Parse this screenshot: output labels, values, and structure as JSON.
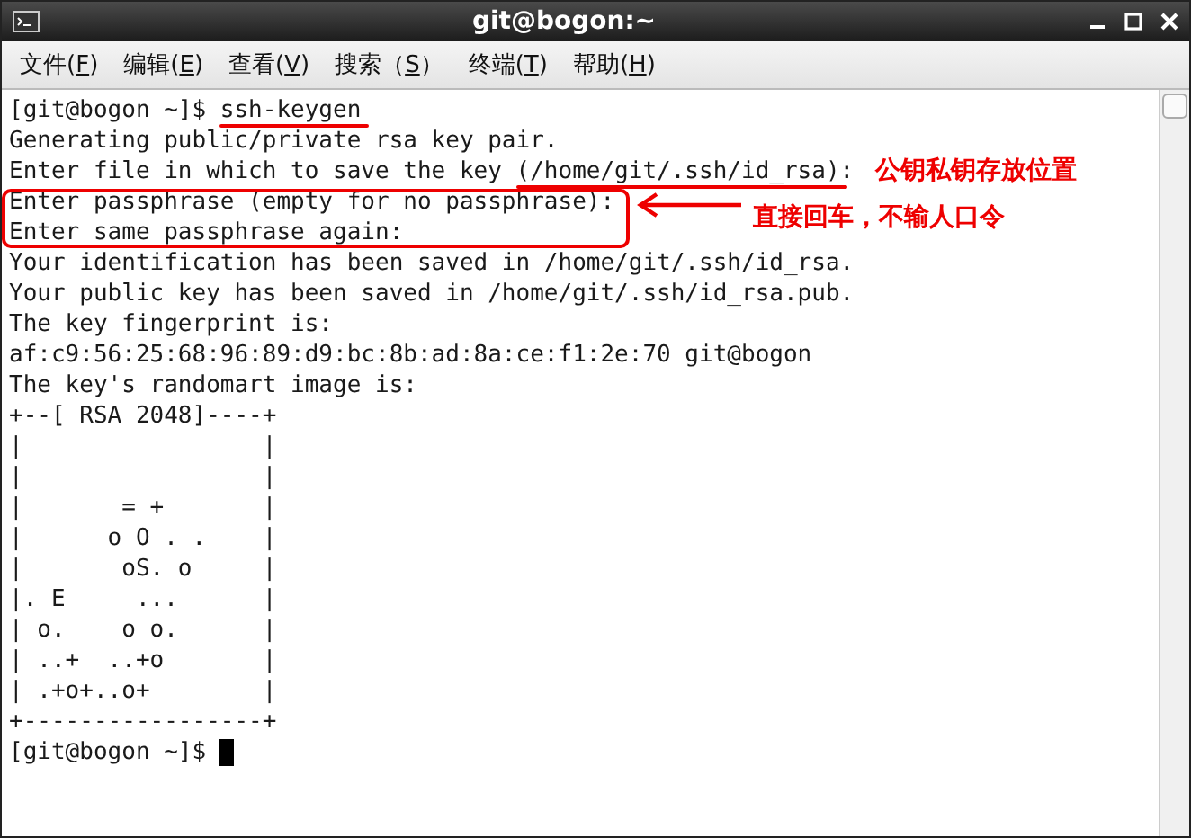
{
  "window": {
    "title": "git@bogon:~"
  },
  "menu": [
    {
      "label_before": "文件(",
      "mnemonic": "F",
      "label_after": ")"
    },
    {
      "label_before": "编辑(",
      "mnemonic": "E",
      "label_after": ")"
    },
    {
      "label_before": "查看(",
      "mnemonic": "V",
      "label_after": ")"
    },
    {
      "label_before": "搜索（",
      "mnemonic": "S",
      "label_after": "）"
    },
    {
      "label_before": "终端(",
      "mnemonic": "T",
      "label_after": ")"
    },
    {
      "label_before": "帮助(",
      "mnemonic": "H",
      "label_after": ")"
    }
  ],
  "terminal": {
    "lines": [
      "[git@bogon ~]$ ssh-keygen",
      "Generating public/private rsa key pair.",
      "Enter file in which to save the key (/home/git/.ssh/id_rsa):",
      "Enter passphrase (empty for no passphrase):",
      "Enter same passphrase again:",
      "Your identification has been saved in /home/git/.ssh/id_rsa.",
      "Your public key has been saved in /home/git/.ssh/id_rsa.pub.",
      "The key fingerprint is:",
      "af:c9:56:25:68:96:89:d9:bc:8b:ad:8a:ce:f1:2e:70 git@bogon",
      "The key's randomart image is:",
      "+--[ RSA 2048]----+",
      "|                 |",
      "|                 |",
      "|       = +       |",
      "|      o O . .    |",
      "|       oS. o     |",
      "|. E     ...      |",
      "| o.    o o.      |",
      "| ..+  ..+o       |",
      "| .+o+..o+        |",
      "+-----------------+",
      "[git@bogon ~]$"
    ]
  },
  "annotations": {
    "key_location_note": "公钥私钥存放位置",
    "passphrase_note": "直接回车，不输人口令"
  }
}
